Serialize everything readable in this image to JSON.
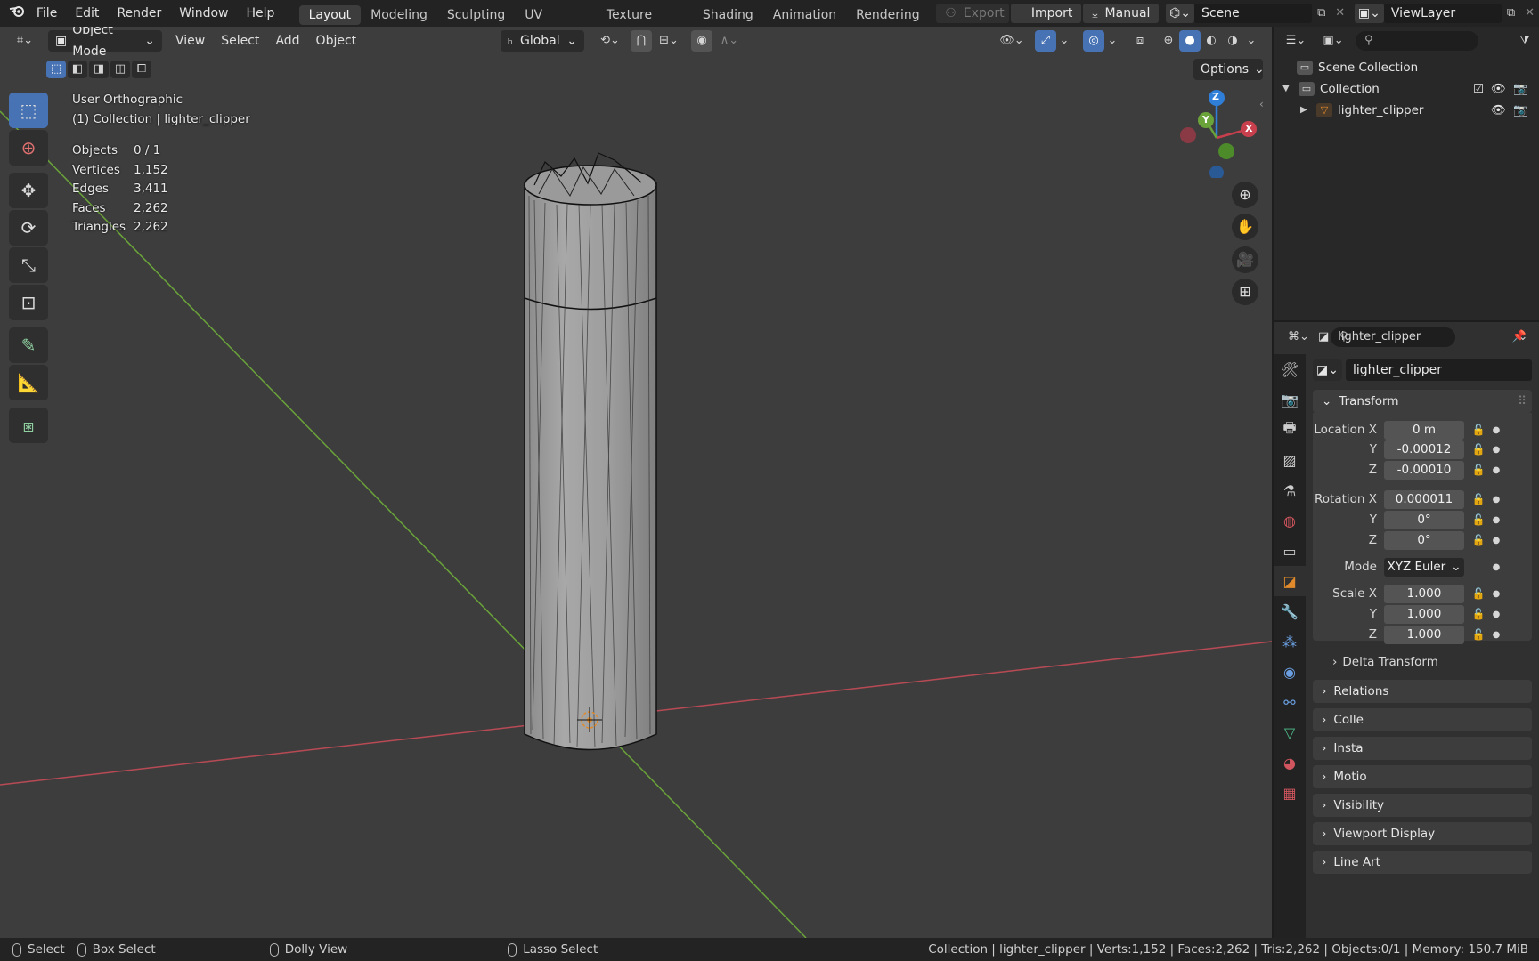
{
  "topbar": {
    "menus": [
      "File",
      "Edit",
      "Render",
      "Window",
      "Help"
    ],
    "workspaces": [
      "Layout",
      "Modeling",
      "Sculpting",
      "UV Editing",
      "Texture Paint",
      "Shading",
      "Animation",
      "Rendering"
    ],
    "active_workspace": "Layout",
    "export_label": "Export",
    "import_label": "Import",
    "manual_label": "Manual",
    "scene_name": "Scene",
    "view_layer": "ViewLayer"
  },
  "viewport": {
    "mode": "Object Mode",
    "menus": [
      "View",
      "Select",
      "Add",
      "Object"
    ],
    "orientation": "Global",
    "options_label": "Options",
    "view_name": "User Orthographic",
    "collection_info": "(1) Collection | lighter_clipper",
    "stats": [
      {
        "label": "Objects",
        "value": "0 / 1"
      },
      {
        "label": "Vertices",
        "value": "1,152"
      },
      {
        "label": "Edges",
        "value": "3,411"
      },
      {
        "label": "Faces",
        "value": "2,262"
      },
      {
        "label": "Triangles",
        "value": "2,262"
      }
    ],
    "gizmo": {
      "z": "Z",
      "y": "Y",
      "x": "X"
    }
  },
  "outliner": {
    "scene_collection": "Scene Collection",
    "collection": "Collection",
    "object": "lighter_clipper"
  },
  "properties": {
    "object_name": "lighter_clipper",
    "datablock_name": "lighter_clipper",
    "transform_title": "Transform",
    "location_label": "Location X",
    "rotation_label": "Rotation X",
    "scale_label": "Scale X",
    "y_label": "Y",
    "z_label": "Z",
    "mode_label": "Mode",
    "location": [
      "0 m",
      "-0.00012",
      "-0.00010"
    ],
    "rotation": [
      "0.000011",
      "0°",
      "0°"
    ],
    "mode_value": "XYZ Euler",
    "scale": [
      "1.000",
      "1.000",
      "1.000"
    ],
    "panels": [
      "Delta Transform",
      "Relations",
      "Colle",
      "Insta",
      "Motio",
      "Visibility",
      "Viewport Display",
      "Line Art"
    ]
  },
  "statusbar": {
    "select": "Select",
    "box_select": "Box Select",
    "dolly_view": "Dolly View",
    "lasso_select": "Lasso Select",
    "info": "Collection | lighter_clipper | Verts:1,152 | Faces:2,262 | Tris:2,262 | Objects:0/1 | Memory: 150.7 MiB"
  },
  "colors": {
    "accent": "#4772b3",
    "axis_x": "#c8404d",
    "axis_y": "#6aa33a",
    "axis_z": "#2f7fd9",
    "object_orange": "#e08a2c"
  }
}
